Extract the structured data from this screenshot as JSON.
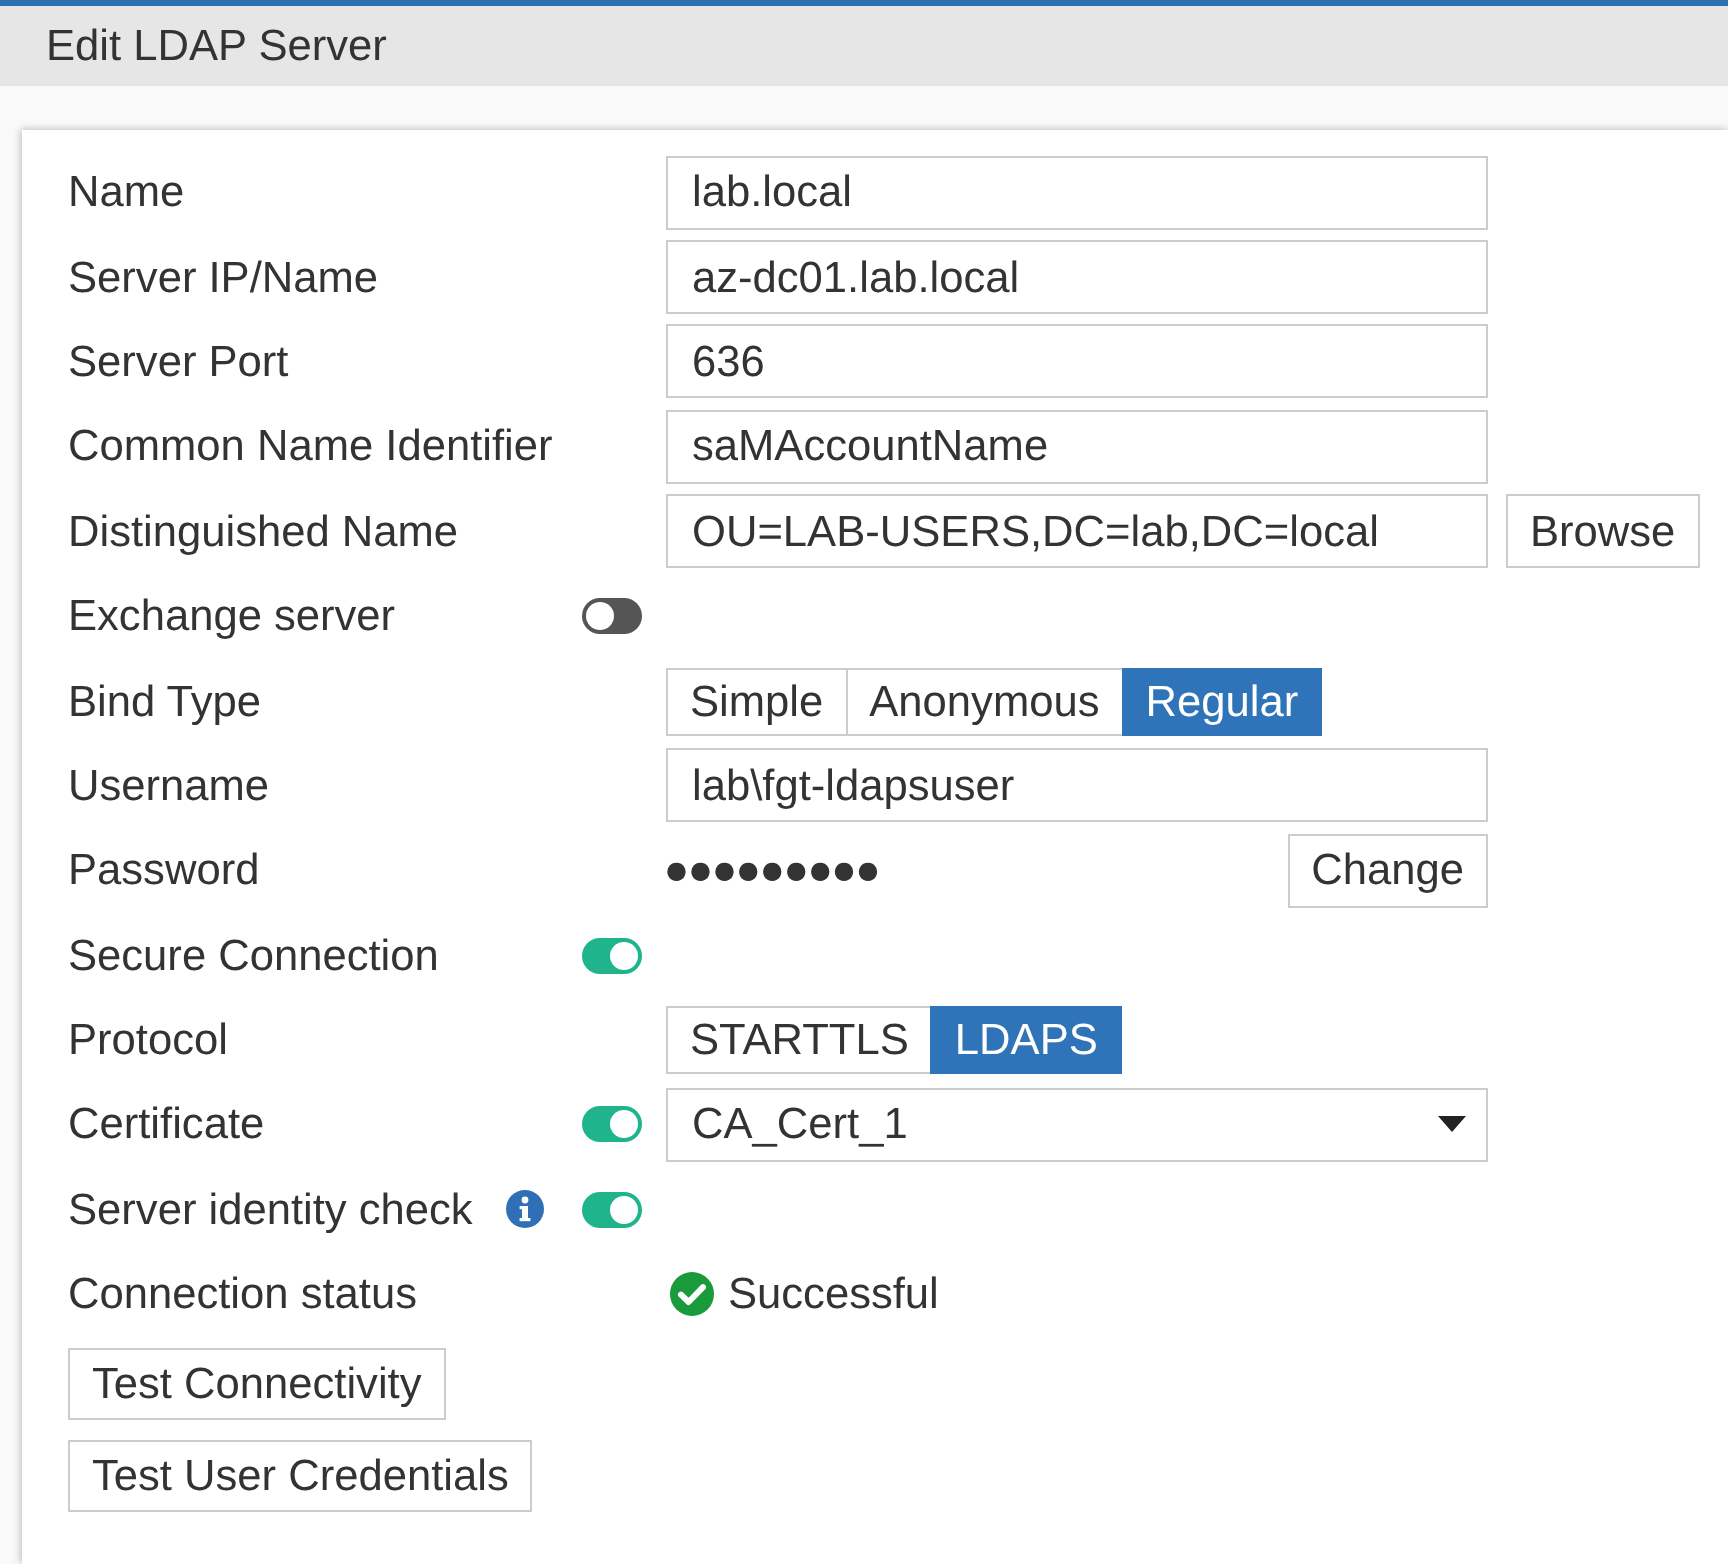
{
  "header": {
    "title": "Edit LDAP Server"
  },
  "fields": [
    {
      "kind": "text",
      "label": "Name",
      "value": "lab.local"
    },
    {
      "kind": "text",
      "label": "Server IP/Name",
      "value": "az-dc01.lab.local"
    },
    {
      "kind": "text",
      "label": "Server Port",
      "value": "636"
    },
    {
      "kind": "text",
      "label": "Common Name Identifier",
      "value": "saMAccountName"
    },
    {
      "kind": "text",
      "label": "Distinguished Name",
      "value": "OU=LAB-USERS,DC=lab,DC=local",
      "button": "Browse"
    },
    {
      "kind": "toggle",
      "label": "Exchange server",
      "on": false
    },
    {
      "kind": "segmented",
      "label": "Bind Type",
      "options": [
        {
          "label": "Simple",
          "selected": false
        },
        {
          "label": "Anonymous",
          "selected": false
        },
        {
          "label": "Regular",
          "selected": true
        }
      ]
    },
    {
      "kind": "text",
      "label": "Username",
      "value": "lab\\fgt-ldapsuser"
    },
    {
      "kind": "password",
      "label": "Password",
      "value": "●●●●●●●●●",
      "button": "Change"
    },
    {
      "kind": "toggle",
      "label": "Secure Connection",
      "on": true
    },
    {
      "kind": "segmented",
      "label": "Protocol",
      "options": [
        {
          "label": "STARTTLS",
          "selected": false
        },
        {
          "label": "LDAPS",
          "selected": true
        }
      ]
    },
    {
      "kind": "select",
      "label": "Certificate",
      "on": true,
      "value": "CA_Cert_1"
    },
    {
      "kind": "toggle",
      "label": "Server identity check",
      "on": true,
      "info": true
    },
    {
      "kind": "status",
      "label": "Connection status",
      "value": "Successful",
      "ok": true
    }
  ],
  "buttons": [
    "Test Connectivity",
    "Test User Credentials"
  ]
}
